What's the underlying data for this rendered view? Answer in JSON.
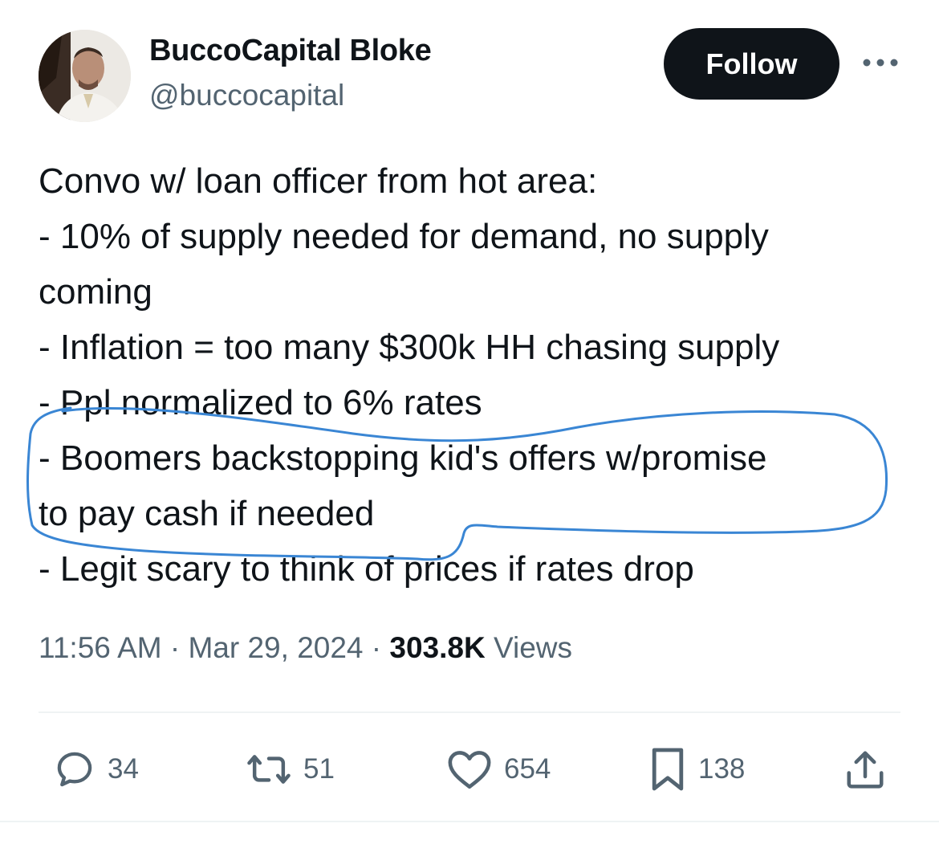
{
  "user": {
    "display_name": "BuccoCapital Bloke",
    "handle": "@buccocapital"
  },
  "follow_label": "Follow",
  "tweet": {
    "lines": [
      "Convo w/ loan officer from hot area:",
      "- 10% of supply needed for demand, no supply",
      "coming",
      "- Inflation = too many $300k HH chasing supply",
      "- Ppl normalized to 6% rates",
      "- Boomers backstopping kid's offers w/promise",
      "to pay cash if needed",
      "- Legit scary to think of prices if rates drop"
    ],
    "highlight_color": "#3a86d4"
  },
  "meta": {
    "time": "11:56 AM",
    "date": "Mar 29, 2024",
    "views_count": "303.8K",
    "views_label": "Views",
    "separator": "·"
  },
  "actions": {
    "replies": "34",
    "retweets": "51",
    "likes": "654",
    "bookmarks": "138"
  },
  "icons": {
    "reply": "reply-icon",
    "retweet": "retweet-icon",
    "like": "heart-icon",
    "bookmark": "bookmark-icon",
    "share": "share-icon",
    "more": "more-icon"
  }
}
